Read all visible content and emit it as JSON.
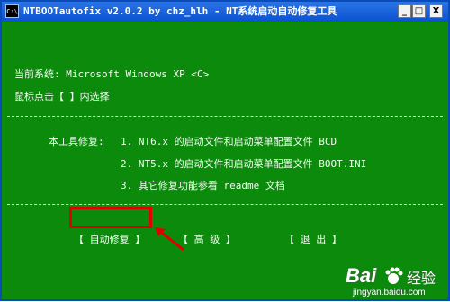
{
  "window": {
    "icon_text": "C:\\",
    "title": "NTBOOTautofix v2.0.2 by chz_hlh - NT系统启动自动修复工具",
    "min_label": "_",
    "max_label": "□",
    "close_label": "X"
  },
  "content": {
    "current_system": "当前系统: Microsoft Windows XP  <C>",
    "instruction": "鼠标点击【 】内选择",
    "intro": "本工具修复: ",
    "items": [
      "1. NT6.x 的启动文件和启动菜单配置文件 BCD",
      "2. NT5.x 的启动文件和启动菜单配置文件 BOOT.INI",
      "3. 其它修复功能参看 readme 文档"
    ]
  },
  "buttons": {
    "auto_fix": "【 自动修复 】",
    "advanced": "【  高  级  】",
    "exit": "【  退  出  】"
  },
  "watermark": {
    "brand": "Bai",
    "brand_jingyan": "经验",
    "url": "jingyan.baidu.com"
  },
  "colors": {
    "background": "#0b8a0b",
    "titlebar": "#0a52d1",
    "highlight": "#e00000"
  }
}
